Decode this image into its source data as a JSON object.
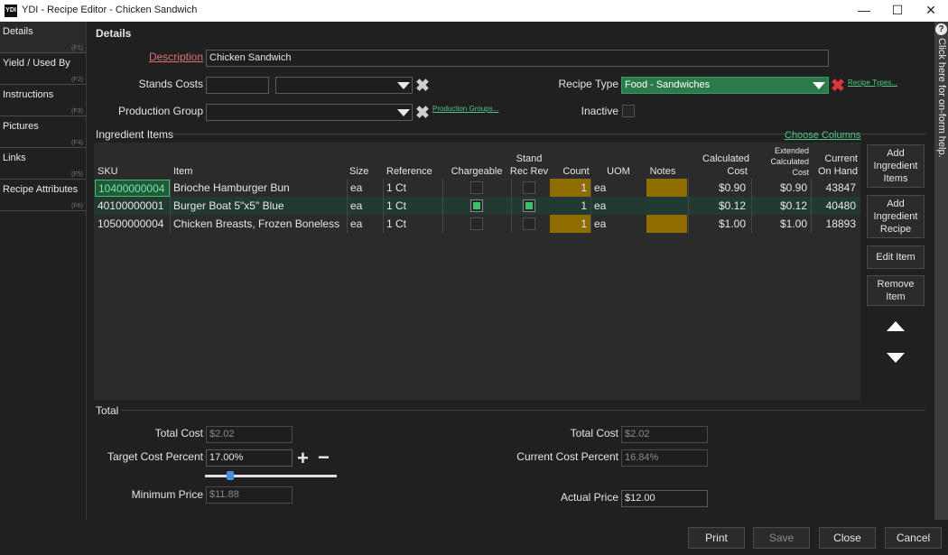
{
  "window": {
    "app_icon_text": "YDI",
    "title": "YDI - Recipe Editor - Chicken Sandwich"
  },
  "tabs": [
    {
      "label": "Details",
      "fkey": "(F1)"
    },
    {
      "label": "Yield / Used By",
      "fkey": "(F2)"
    },
    {
      "label": "Instructions",
      "fkey": "(F3)"
    },
    {
      "label": "Pictures",
      "fkey": "(F4)"
    },
    {
      "label": "Links",
      "fkey": "(F5)"
    },
    {
      "label": "Recipe Attributes",
      "fkey": "(F6)"
    }
  ],
  "help": {
    "icon": "?",
    "text": "Click here for on-form help."
  },
  "details": {
    "heading": "Details",
    "description_label": "Description",
    "description_value": "Chicken Sandwich",
    "stands_costs_label": "Stands Costs",
    "stands_costs_value": "",
    "stands_costs_dropdown": "",
    "production_group_label": "Production Group",
    "production_group_value": "",
    "production_groups_link": "Production Groups...",
    "recipe_type_label": "Recipe Type",
    "recipe_type_value": "Food - Sandwiches",
    "recipe_types_link": "Recipe Types...",
    "inactive_label": "Inactive",
    "inactive_checked": false
  },
  "ingredients": {
    "heading": "Ingredient Items",
    "choose_columns": "Choose Columns",
    "columns": {
      "sku": "SKU",
      "item": "Item",
      "size": "Size",
      "reference": "Reference",
      "chargeable": "Chargeable",
      "stand_rec_rev_1": "Stand",
      "stand_rec_rev_2": "Rec Rev",
      "count": "Count",
      "uom": "UOM",
      "notes": "Notes",
      "calc_cost_1": "Calculated",
      "calc_cost_2": "Cost",
      "ext_cost_1": "Extended",
      "ext_cost_2": "Calculated",
      "ext_cost_3": "Cost",
      "on_hand_1": "Current",
      "on_hand_2": "On Hand"
    },
    "rows": [
      {
        "sku": "10400000004",
        "item": "Brioche Hamburger Bun",
        "size": "ea",
        "reference": "1 Ct",
        "chargeable": false,
        "stand_rec_rev": false,
        "count": "1",
        "uom": "ea",
        "notes": "",
        "calc_cost": "$0.90",
        "ext_cost": "$0.90",
        "on_hand": "43847"
      },
      {
        "sku": "40100000001",
        "item": "Burger Boat 5\"x5\" Blue",
        "size": "ea",
        "reference": "1 Ct",
        "chargeable": true,
        "stand_rec_rev": true,
        "count": "1",
        "uom": "ea",
        "notes": "",
        "calc_cost": "$0.12",
        "ext_cost": "$0.12",
        "on_hand": "40480"
      },
      {
        "sku": "10500000004",
        "item": "Chicken Breasts, Frozen Boneless",
        "size": "ea",
        "reference": "1 Ct",
        "chargeable": false,
        "stand_rec_rev": false,
        "count": "1",
        "uom": "ea",
        "notes": "",
        "calc_cost": "$1.00",
        "ext_cost": "$1.00",
        "on_hand": "18893"
      }
    ],
    "buttons": {
      "add_items_1": "Add",
      "add_items_2": "Ingredient",
      "add_items_3": "Items",
      "add_recipe_1": "Add",
      "add_recipe_2": "Ingredient",
      "add_recipe_3": "Recipe",
      "edit_item": "Edit Item",
      "remove_item_1": "Remove",
      "remove_item_2": "Item"
    }
  },
  "total": {
    "heading": "Total",
    "total_cost_label": "Total Cost",
    "total_cost_value": "$2.02",
    "target_cost_percent_label": "Target Cost Percent",
    "target_cost_percent_value": "17.00%",
    "target_slider_fraction": 0.17,
    "minimum_price_label": "Minimum Price",
    "minimum_price_value": "$11.88",
    "total_cost_right_label": "Total Cost",
    "total_cost_right_value": "$2.02",
    "current_cost_percent_label": "Current Cost Percent",
    "current_cost_percent_value": "16.84%",
    "actual_price_label": "Actual Price",
    "actual_price_value": "$12.00"
  },
  "footer": {
    "print": "Print",
    "save": "Save",
    "close": "Close",
    "cancel": "Cancel"
  }
}
